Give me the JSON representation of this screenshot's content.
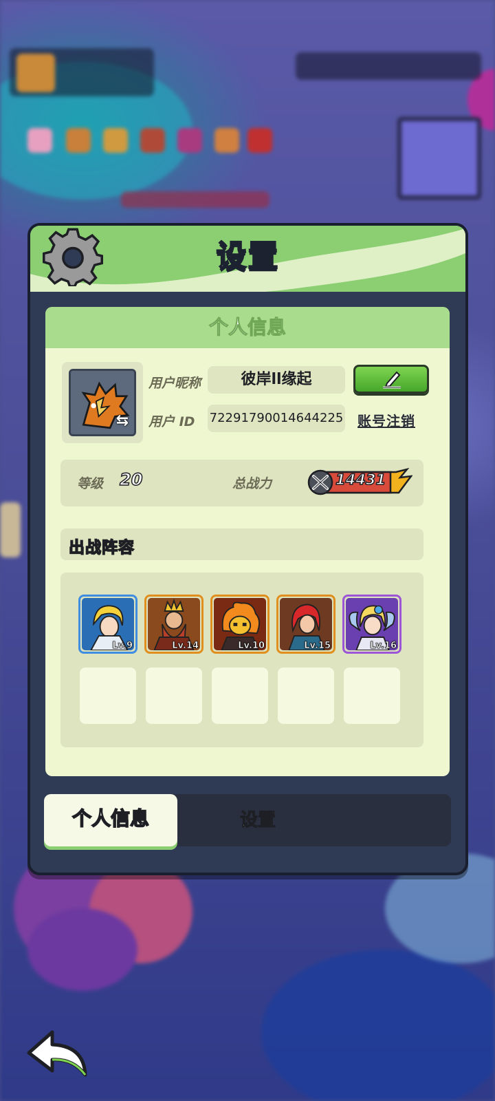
{
  "dialog": {
    "title": "设置",
    "icon": "gear-icon"
  },
  "profile": {
    "section_title": "个人信息",
    "nickname_label": "用户昵称",
    "nickname": "彼岸ll缘起",
    "id_label": "用户 ID",
    "user_id": "72291790014644225",
    "cancel_account_label": "账号注销",
    "edit_icon": "pencil-icon",
    "swap_icon": "swap-icon"
  },
  "stats": {
    "level_label": "等级",
    "level": "20",
    "power_label": "总战力",
    "power": "14431",
    "power_icon": "crossed-swords-icon"
  },
  "lineup": {
    "title": "出战阵容",
    "heroes": [
      {
        "level": "Lv.9",
        "frame_color": "#3f8de0",
        "bg_color": "#2a6fb5"
      },
      {
        "level": "Lv.14",
        "frame_color": "#e08f1f",
        "bg_color": "#8a4a1e"
      },
      {
        "level": "Lv.10",
        "frame_color": "#e08f1f",
        "bg_color": "#7a2a12"
      },
      {
        "level": "Lv.15",
        "frame_color": "#e08f1f",
        "bg_color": "#6e3a22"
      },
      {
        "level": "Lv.16",
        "frame_color": "#9c55d6",
        "bg_color": "#6a3fb0"
      }
    ],
    "empty_slots": 5
  },
  "tabs": {
    "active": "个人信息",
    "inactive": "设置"
  },
  "colors": {
    "header_green": "#8ccf73",
    "panel_bg": "#eef7cf",
    "dialog_bg": "#2f3a55"
  }
}
